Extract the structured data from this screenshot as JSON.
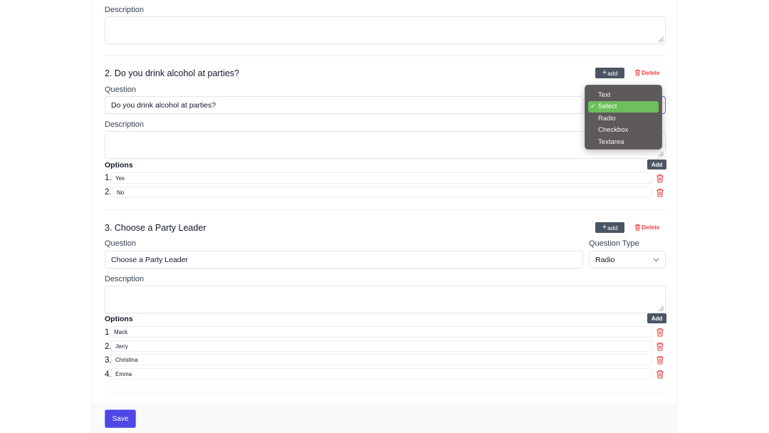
{
  "labels": {
    "question": "Question",
    "description": "Description",
    "question_type": "Question Type",
    "options": "Options",
    "add": "add",
    "delete": "Delete",
    "option_add": "Add"
  },
  "section1": {
    "description_value": ""
  },
  "questions": [
    {
      "title": "2. Do you drink alcohol at parties?",
      "question_value": "Do you drink alcohol at parties?",
      "description_value": "",
      "type": "Select",
      "options": [
        {
          "num": "1.",
          "value": "Yes"
        },
        {
          "num": "2.",
          "value": "No"
        }
      ]
    },
    {
      "title": "3. Choose a Party Leader",
      "question_value": "Choose a Party Leader",
      "description_value": "",
      "type": "Radio",
      "options": [
        {
          "num": "1.",
          "value": "Mack"
        },
        {
          "num": "2.",
          "value": "Jerry"
        },
        {
          "num": "3.",
          "value": "Christina"
        },
        {
          "num": "4.",
          "value": "Emma"
        }
      ]
    }
  ],
  "type_dropdown": {
    "open": true,
    "selected": "Select",
    "items": [
      "Text",
      "Select",
      "Radio",
      "Checkbox",
      "Textarea"
    ]
  },
  "footer": {
    "save_label": "Save"
  },
  "colors": {
    "primary": "#4f46e5",
    "danger": "#ef4444",
    "dark_button": "#4b5563",
    "dropdown_bg": "#5f5a5a",
    "dropdown_selected": "#6cbf5a"
  }
}
